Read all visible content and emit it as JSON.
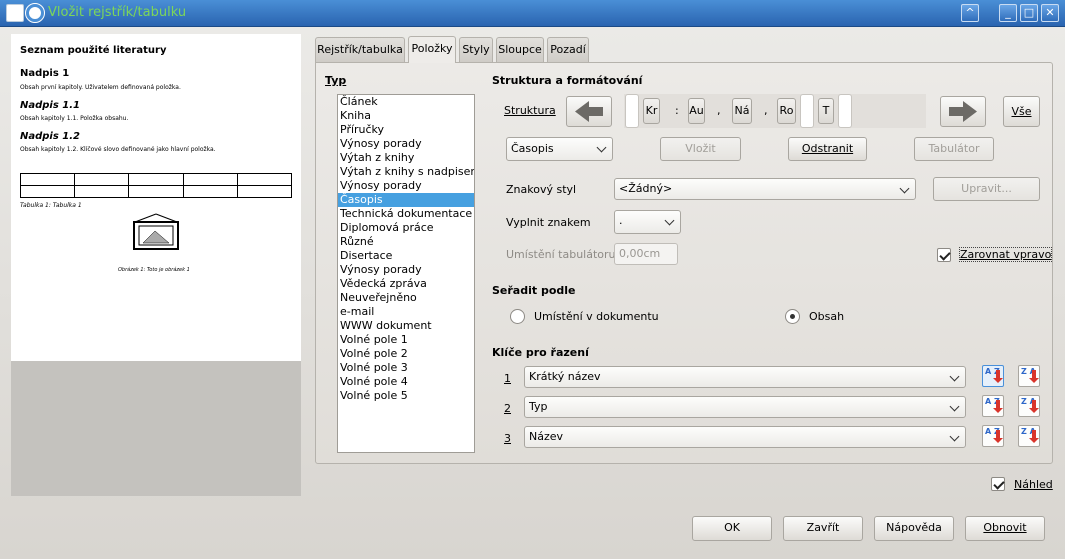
{
  "window": {
    "title": "Vložit rejstřík/tabulku",
    "buttons": {
      "minimize": "_",
      "maximize": "□",
      "close": "✕",
      "extra": "^"
    }
  },
  "preview": {
    "heading": "Seznam použité literatury",
    "h1": "Nadpis 1",
    "p1": "Obsah první kapitoly. Uživatelem definovaná položka.",
    "h11": "Nadpis 1.1",
    "p11": "Obsah kapitoly 1.1. Položka obsahu.",
    "h12": "Nadpis 1.2",
    "p12": "Obsah kapitoly 1.2. Klíčové slovo definované jako hlavní položka.",
    "table_caption": "Tabulka 1: Tabulka 1",
    "image_caption": "Obrázek 1: Toto je obrázek 1"
  },
  "tabs": [
    "Rejstřík/tabulka",
    "Položky",
    "Styly",
    "Sloupce",
    "Pozadí"
  ],
  "active_tab": "Položky",
  "typ": {
    "label": "Typ",
    "items": [
      "Článek",
      "Kniha",
      "Příručky",
      "Výnosy porady",
      "Výtah z knihy",
      "Výtah z knihy s nadpisem",
      "Výnosy porady",
      "Časopis",
      "Technická dokumentace",
      "Diplomová práce",
      "Různé",
      "Disertace",
      "Výnosy porady",
      "Vědecká zpráva",
      "Neuveřejněno",
      "e-mail",
      "WWW dokument",
      "Volné pole 1",
      "Volné pole 2",
      "Volné pole 3",
      "Volné pole 4",
      "Volné pole 5"
    ],
    "selected": "Časopis"
  },
  "structure": {
    "section_title": "Struktura a formátování",
    "label": "Struktura",
    "tokens": [
      "Kr",
      "Au",
      "Ná",
      "Ro",
      "T"
    ],
    "separators": [
      ":",
      ",",
      ","
    ],
    "all_button": "Vše",
    "type_combo": "Časopis",
    "insert_button": "Vložit",
    "remove_button": "Odstranit",
    "tab_button": "Tabulátor"
  },
  "char_style": {
    "label": "Znakový styl",
    "value": "<Žádný>",
    "edit_button": "Upravit..."
  },
  "fill_char": {
    "label": "Vyplnit znakem",
    "value": "."
  },
  "tab_position": {
    "label": "Umístění tabulátoru",
    "value": "0,00cm"
  },
  "align_right": {
    "label": "Zarovnat vpravo",
    "checked": true
  },
  "sort_by": {
    "title": "Seřadit podle",
    "options": [
      "Umístění v dokumentu",
      "Obsah"
    ],
    "selected": "Obsah"
  },
  "sort_keys": {
    "title": "Klíče pro řazení",
    "rows": [
      {
        "num": "1",
        "value": "Krátký název"
      },
      {
        "num": "2",
        "value": "Typ"
      },
      {
        "num": "3",
        "value": "Název"
      }
    ],
    "asc_label": "A Z",
    "desc_label": "Z A"
  },
  "preview_check": {
    "label": "Náhled",
    "checked": true
  },
  "footer": {
    "ok": "OK",
    "close": "Zavřít",
    "help": "Nápověda",
    "reset": "Obnovit"
  },
  "colors": {
    "title_bar": "#2a64b0",
    "title_text": "#7dd65a",
    "selection": "#46a0e0"
  }
}
